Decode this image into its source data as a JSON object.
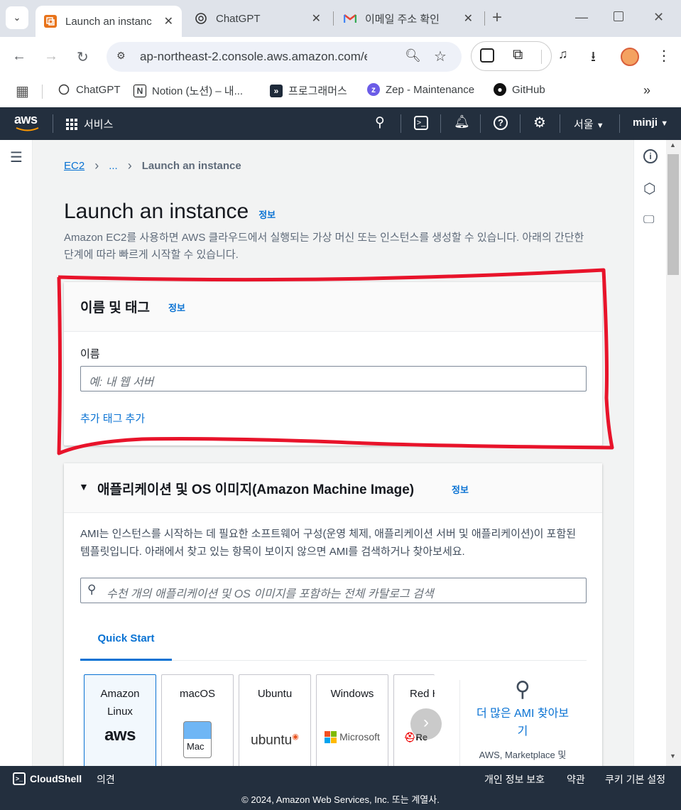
{
  "browser": {
    "tabs": [
      {
        "title": "Launch an instanc",
        "active": true
      },
      {
        "title": "ChatGPT",
        "active": false
      },
      {
        "title": "이메일 주소 확인",
        "active": false
      }
    ],
    "url": "ap-northeast-2.console.aws.amazon.com/ec...",
    "bookmarks": [
      "ChatGPT",
      "Notion (노션) – 내...",
      "프로그래머스",
      "Zep - Maintenance",
      "GitHub"
    ]
  },
  "aws_header": {
    "services": "서비스",
    "region": "서울",
    "user": "minji"
  },
  "breadcrumb": {
    "root": "EC2",
    "middle": "...",
    "current": "Launch an instance"
  },
  "page": {
    "title": "Launch an instance",
    "info": "정보",
    "description": "Amazon EC2를 사용하면 AWS 클라우드에서 실행되는 가상 머신 또는 인스턴스를 생성할 수 있습니다. 아래의 간단한 단계에 따라 빠르게 시작할 수 있습니다."
  },
  "name_tags": {
    "heading": "이름 및 태그",
    "info": "정보",
    "label": "이름",
    "placeholder": "예: 내 웹 서버",
    "add_tags": "추가 태그 추가"
  },
  "ami_section": {
    "heading": "애플리케이션 및 OS 이미지(Amazon Machine Image)",
    "info": "정보",
    "description": "AMI는 인스턴스를 시작하는 데 필요한 소프트웨어 구성(운영 체제, 애플리케이션 서버 및 애플리케이션)이 포함된 템플릿입니다. 아래에서 찾고 있는 항목이 보이지 않으면 AMI를 검색하거나 찾아보세요.",
    "search_placeholder": "수천 개의 애플리케이션 및 OS 이미지를 포함하는 전체 카탈로그 검색",
    "tab": "Quick Start",
    "tiles": [
      {
        "name": "Amazon Linux",
        "logo": "aws"
      },
      {
        "name": "macOS",
        "logo": "Mac"
      },
      {
        "name": "Ubuntu",
        "logo": "ubuntu"
      },
      {
        "name": "Windows",
        "logo": "Microsoft"
      },
      {
        "name": "Red H",
        "logo": "Re"
      }
    ],
    "more_ami": "더 많은 AMI 찾아보기",
    "more_sub": "AWS, Marketplace 및"
  },
  "footer": {
    "cloudshell": "CloudShell",
    "feedback": "의견",
    "privacy": "개인 정보 보호",
    "terms": "약관",
    "cookies": "쿠키 기본 설정",
    "copyright": "© 2024, Amazon Web Services, Inc. 또는 계열사."
  },
  "colors": {
    "annotation": "#e8132a",
    "link": "#0972d3",
    "aws_nav": "#232f3e"
  }
}
